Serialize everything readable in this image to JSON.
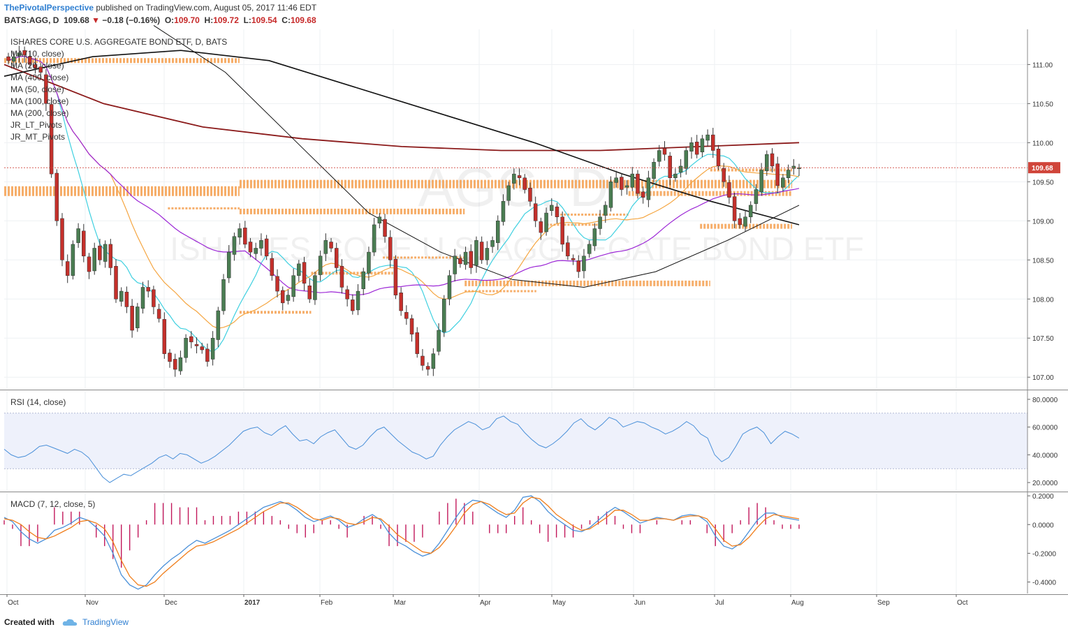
{
  "header": {
    "author": "ThePivotalPerspective",
    "published_text": "published on TradingView.com, August 05, 2017 11:46 EDT",
    "symbol": "BATS:AGG, D",
    "last": "109.68",
    "change": "−0.18 (−0.16%)",
    "o_label": "O:",
    "o_value": "109.70",
    "h_label": "H:",
    "h_value": "109.72",
    "l_label": "L:",
    "l_value": "109.54",
    "c_label": "C:",
    "c_value": "109.68"
  },
  "legend": {
    "title": "ISHARES CORE U.S. AGGREGATE BOND ETF, D, BATS",
    "items": [
      "MA (10, close)",
      "MA (20, close)",
      "MA (400, close)",
      "MA (50, close)",
      "MA (100, close)",
      "MA (200, close)",
      "JR_LT_Pivots",
      "JR_MT_Pivots"
    ]
  },
  "watermark": {
    "symbol": "AGG, D",
    "name": "ISHARES CORE U.S. AGGREGATE BOND ETF"
  },
  "rsi_label": "RSI (14, close)",
  "macd_label": "MACD (7, 12, close, 5)",
  "footer": {
    "created_with": "Created with",
    "brand": "TradingView"
  },
  "colors": {
    "up": "#4a7d52",
    "down": "#c4302b",
    "ma10": "#3fd0e0",
    "ma20": "#f5a642",
    "ma50": "#9c27d6",
    "ma_black": "#111111",
    "ma200": "#8b1a1a",
    "pivots": "#f5a050",
    "rsi": "#4a90d9",
    "macd": "#4a90d9",
    "signal": "#f07d1a",
    "hist": "#c2185b",
    "last_price_bg": "#d0453a"
  },
  "chart_data": [
    {
      "type": "candlestick",
      "title": "BATS:AGG, D",
      "x_ticks": [
        "Oct",
        "Nov",
        "Dec",
        "2017",
        "Feb",
        "Mar",
        "Apr",
        "May",
        "Jun",
        "Jul",
        "Aug",
        "Sep",
        "Oct"
      ],
      "y_ticks": [
        "107.00",
        "107.50",
        "108.00",
        "108.50",
        "109.00",
        "109.50",
        "110.00",
        "110.50",
        "111.00"
      ],
      "ylim": [
        106.85,
        111.45
      ],
      "last_price_label": "109.68",
      "last_price": 109.68,
      "closes": [
        111.05,
        111.1,
        111.15,
        111.12,
        111.0,
        110.95,
        110.9,
        110.5,
        109.6,
        109.0,
        108.5,
        108.3,
        108.7,
        108.9,
        108.55,
        108.35,
        108.65,
        108.5,
        108.7,
        108.4,
        108.0,
        108.1,
        107.9,
        107.6,
        107.9,
        108.15,
        108.1,
        107.9,
        107.75,
        107.3,
        107.2,
        107.1,
        107.25,
        107.5,
        107.45,
        107.4,
        107.35,
        107.2,
        107.5,
        107.85,
        108.25,
        108.6,
        108.8,
        108.9,
        108.7,
        108.6,
        108.65,
        108.75,
        108.55,
        108.3,
        108.1,
        107.95,
        108.05,
        108.3,
        108.45,
        108.2,
        108.0,
        108.3,
        108.55,
        108.75,
        108.65,
        108.4,
        108.15,
        108.0,
        107.85,
        108.1,
        108.35,
        108.6,
        108.95,
        109.05,
        108.8,
        108.5,
        108.05,
        107.85,
        107.75,
        107.55,
        107.3,
        107.15,
        107.1,
        107.3,
        107.6,
        108.0,
        108.3,
        108.55,
        108.45,
        108.6,
        108.4,
        108.75,
        108.5,
        108.65,
        108.75,
        109.0,
        109.25,
        109.45,
        109.6,
        109.55,
        109.4,
        109.25,
        109.0,
        108.85,
        109.1,
        109.2,
        109.05,
        108.7,
        108.55,
        108.5,
        108.35,
        108.55,
        108.7,
        108.9,
        109.05,
        109.2,
        109.5,
        109.55,
        109.4,
        109.45,
        109.6,
        109.35,
        109.3,
        109.55,
        109.75,
        109.9,
        109.85,
        109.55,
        109.6,
        109.7,
        109.9,
        110.0,
        109.85,
        110.05,
        110.1,
        109.9,
        109.7,
        109.5,
        109.3,
        109.0,
        108.95,
        109.05,
        109.2,
        109.4,
        109.65,
        109.85,
        109.7,
        109.45,
        109.55,
        109.65,
        109.7,
        109.68
      ],
      "volume_note": ""
    },
    {
      "type": "line",
      "title": "RSI (14, close)",
      "y_ticks": [
        "20.0000",
        "40.0000",
        "60.0000",
        "80.0000"
      ],
      "ylim": [
        14,
        86
      ],
      "band": [
        30,
        70
      ],
      "values": [
        44,
        40,
        38,
        39,
        42,
        46,
        47,
        45,
        43,
        41,
        44,
        42,
        38,
        31,
        24,
        20,
        23,
        26,
        25,
        28,
        31,
        34,
        38,
        40,
        37,
        41,
        40,
        37,
        34,
        36,
        39,
        43,
        47,
        52,
        57,
        59,
        60,
        56,
        54,
        58,
        61,
        55,
        50,
        51,
        48,
        53,
        56,
        58,
        52,
        46,
        44,
        47,
        53,
        58,
        60,
        55,
        50,
        46,
        42,
        40,
        37,
        39,
        47,
        53,
        58,
        61,
        64,
        62,
        58,
        60,
        66,
        68,
        64,
        62,
        56,
        51,
        47,
        45,
        48,
        52,
        57,
        63,
        66,
        61,
        58,
        62,
        67,
        65,
        60,
        62,
        64,
        63,
        60,
        58,
        55,
        57,
        60,
        64,
        61,
        55,
        52,
        40,
        35,
        38,
        46,
        55,
        58,
        60,
        56,
        48,
        53,
        57,
        55,
        52
      ],
      "values_note": ""
    },
    {
      "type": "line",
      "title": "MACD (7, 12, close, 5)",
      "y_ticks": [
        "-0.4000",
        "-0.2000",
        "0.0000",
        "0.2000"
      ],
      "ylim": [
        -0.48,
        0.22
      ],
      "macd": [
        0.05,
        0.02,
        -0.05,
        -0.1,
        -0.13,
        -0.1,
        -0.04,
        -0.02,
        0.01,
        0.05,
        0.03,
        -0.02,
        -0.08,
        -0.2,
        -0.35,
        -0.42,
        -0.45,
        -0.42,
        -0.35,
        -0.29,
        -0.24,
        -0.2,
        -0.15,
        -0.11,
        -0.13,
        -0.1,
        -0.07,
        -0.04,
        0.0,
        0.04,
        0.08,
        0.12,
        0.14,
        0.16,
        0.14,
        0.1,
        0.05,
        0.02,
        0.04,
        0.06,
        0.03,
        -0.02,
        0.0,
        0.04,
        0.07,
        0.03,
        -0.06,
        -0.12,
        -0.15,
        -0.19,
        -0.22,
        -0.2,
        -0.13,
        -0.04,
        0.05,
        0.13,
        0.17,
        0.16,
        0.12,
        0.08,
        0.05,
        0.1,
        0.19,
        0.2,
        0.16,
        0.09,
        0.04,
        0.0,
        -0.04,
        -0.05,
        -0.02,
        0.03,
        0.08,
        0.12,
        0.09,
        0.05,
        0.01,
        0.03,
        0.05,
        0.04,
        0.03,
        0.06,
        0.07,
        0.06,
        0.02,
        -0.08,
        -0.15,
        -0.17,
        -0.13,
        -0.05,
        0.03,
        0.08,
        0.08,
        0.05,
        0.04,
        0.03
      ],
      "signal": [
        0.04,
        0.03,
        0.0,
        -0.05,
        -0.09,
        -0.1,
        -0.08,
        -0.05,
        -0.02,
        0.02,
        0.03,
        0.01,
        -0.03,
        -0.12,
        -0.25,
        -0.36,
        -0.42,
        -0.43,
        -0.4,
        -0.34,
        -0.29,
        -0.24,
        -0.19,
        -0.15,
        -0.14,
        -0.12,
        -0.09,
        -0.06,
        -0.03,
        0.01,
        0.05,
        0.09,
        0.12,
        0.15,
        0.15,
        0.12,
        0.08,
        0.04,
        0.03,
        0.05,
        0.04,
        0.01,
        0.0,
        0.02,
        0.05,
        0.04,
        -0.01,
        -0.07,
        -0.11,
        -0.15,
        -0.19,
        -0.2,
        -0.16,
        -0.09,
        -0.01,
        0.08,
        0.14,
        0.16,
        0.14,
        0.1,
        0.07,
        0.08,
        0.15,
        0.19,
        0.18,
        0.13,
        0.07,
        0.03,
        -0.01,
        -0.04,
        -0.03,
        0.01,
        0.05,
        0.1,
        0.1,
        0.07,
        0.03,
        0.03,
        0.04,
        0.04,
        0.03,
        0.05,
        0.06,
        0.06,
        0.04,
        -0.03,
        -0.11,
        -0.15,
        -0.14,
        -0.09,
        -0.02,
        0.04,
        0.07,
        0.06,
        0.05,
        0.04
      ]
    }
  ]
}
